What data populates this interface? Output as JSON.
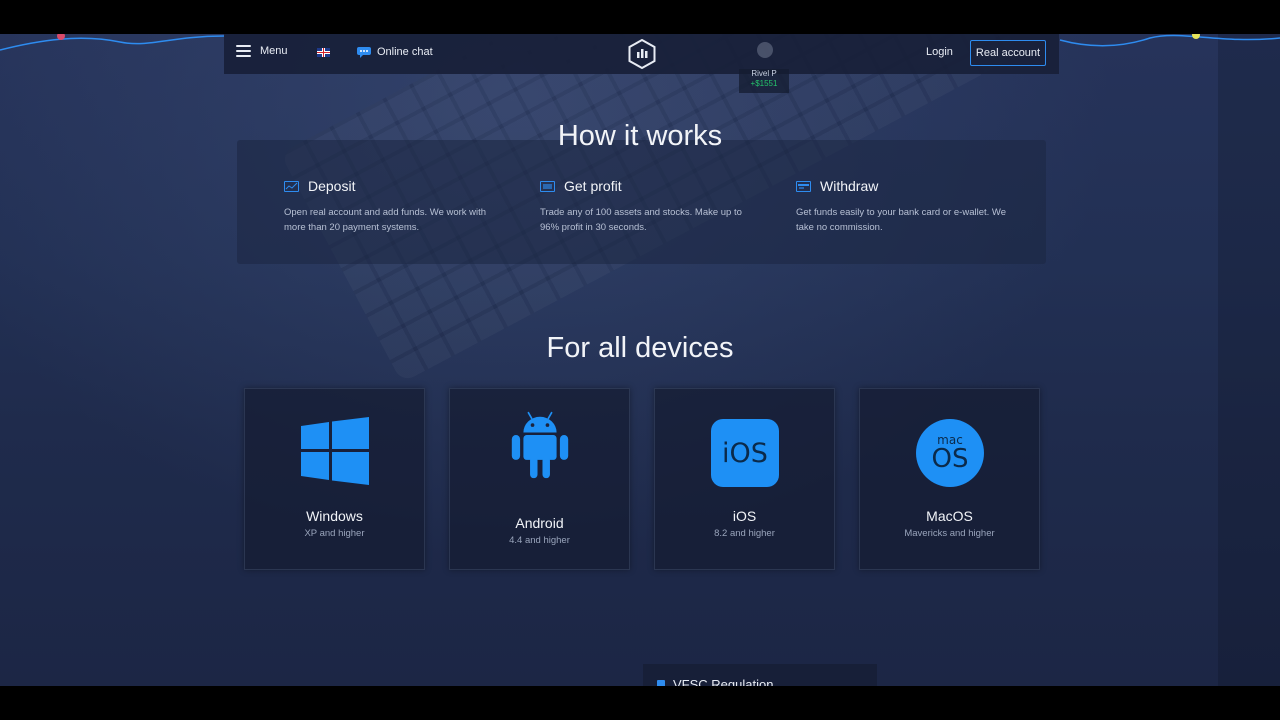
{
  "header": {
    "menu_label": "Menu",
    "language": "English",
    "chat_label": "Online chat",
    "login_label": "Login",
    "real_account_label": "Real account"
  },
  "trade_notification": {
    "name": "Rivel P",
    "amount": "+$1551"
  },
  "how_it_works": {
    "title": "How it works",
    "steps": [
      {
        "icon": "chart-card-icon",
        "title": "Deposit",
        "description": "Open real account and add funds. We work with more than 20 payment systems."
      },
      {
        "icon": "profit-card-icon",
        "title": "Get profit",
        "description": "Trade any of 100 assets and stocks. Make up to 96% profit in 30 seconds."
      },
      {
        "icon": "withdraw-card-icon",
        "title": "Withdraw",
        "description": "Get funds easily to your bank card or e-wallet. We take no commission."
      }
    ]
  },
  "devices": {
    "title": "For all devices",
    "items": [
      {
        "icon": "windows-icon",
        "name": "Windows",
        "subtitle": "XP and higher"
      },
      {
        "icon": "android-icon",
        "name": "Android",
        "subtitle": "4.4 and higher"
      },
      {
        "icon": "ios-icon",
        "name": "iOS",
        "subtitle": "8.2 and higher",
        "logo_text": "iOS"
      },
      {
        "icon": "macos-icon",
        "name": "MacOS",
        "subtitle": "Mavericks and higher",
        "logo_small": "mac",
        "logo_big": "OS"
      }
    ]
  },
  "regulation": {
    "label": "VFSC Regulation"
  },
  "colors": {
    "accent": "#2e8cf0",
    "device_icon": "#1e90f5",
    "profit_green": "#25c46b",
    "background": "#223054"
  }
}
